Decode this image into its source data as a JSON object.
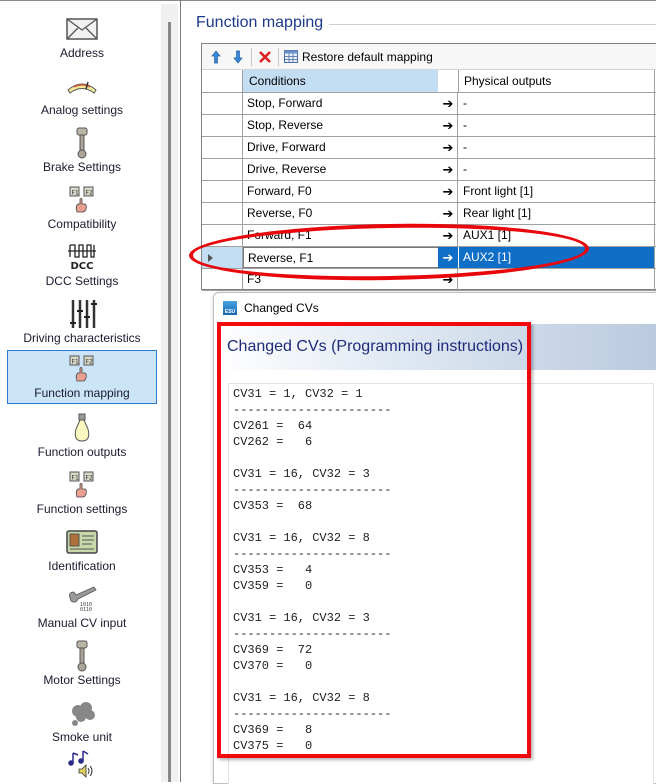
{
  "sidebar": {
    "items": [
      {
        "label": "Address",
        "icon": "envelope-icon",
        "selected": false
      },
      {
        "label": "Analog settings",
        "icon": "gauge-icon",
        "selected": false
      },
      {
        "label": "Brake Settings",
        "icon": "piston-icon",
        "selected": false
      },
      {
        "label": "Compatibility",
        "icon": "function-keys-hand-icon",
        "selected": false
      },
      {
        "label": "DCC Settings",
        "icon": "dcc-signal-icon",
        "icon_text": "DCC",
        "selected": false
      },
      {
        "label": "Driving characteristics",
        "icon": "sliders-icon",
        "selected": false
      },
      {
        "label": "Function mapping",
        "icon": "function-keys-hand-icon",
        "selected": true
      },
      {
        "label": "Function outputs",
        "icon": "light-bulb-icon",
        "selected": false
      },
      {
        "label": "Function settings",
        "icon": "function-keys-hand-icon",
        "selected": false
      },
      {
        "label": "Identification",
        "icon": "id-card-icon",
        "selected": false
      },
      {
        "label": "Manual CV input",
        "icon": "wrench-binary-icon",
        "selected": false
      },
      {
        "label": "Motor Settings",
        "icon": "piston-icon",
        "selected": false
      },
      {
        "label": "Smoke unit",
        "icon": "smoke-icon",
        "selected": false
      },
      {
        "label": "",
        "icon": "sound-notes-icon",
        "selected": false
      }
    ]
  },
  "main": {
    "group_title": "Function mapping",
    "toolbar": {
      "move_up": "arrow-up-icon",
      "move_down": "arrow-down-icon",
      "delete": "delete-x-icon",
      "restore_label": "Restore default mapping"
    },
    "table": {
      "columns": [
        "Conditions",
        "Physical outputs"
      ],
      "arrow_glyph": "➔",
      "rows": [
        {
          "condition": "Stop, Forward",
          "output": "-"
        },
        {
          "condition": "Stop, Reverse",
          "output": "-"
        },
        {
          "condition": "Drive, Forward",
          "output": "-"
        },
        {
          "condition": "Drive, Reverse",
          "output": "-"
        },
        {
          "condition": "Forward, F0",
          "output": "Front light [1]"
        },
        {
          "condition": "Reverse, F0",
          "output": "Rear light [1]"
        },
        {
          "condition": "Forward, F1",
          "output": "AUX1 [1]"
        },
        {
          "condition": "Reverse, F1",
          "output": "AUX2 [1]",
          "selected": true
        },
        {
          "condition": "F3",
          "output": ""
        }
      ]
    }
  },
  "dialog": {
    "title": "Changed CVs",
    "app_icon": "ESU",
    "banner": "Changed CVs (Programming instructions)",
    "cv_lines": [
      "CV31 = 1, CV32 = 1",
      "----------------------",
      "CV261 =  64",
      "CV262 =   6",
      "",
      "CV31 = 16, CV32 = 3",
      "----------------------",
      "CV353 =  68",
      "",
      "CV31 = 16, CV32 = 8",
      "----------------------",
      "CV353 =   4",
      "CV359 =   0",
      "",
      "CV31 = 16, CV32 = 3",
      "----------------------",
      "CV369 =  72",
      "CV370 =   0",
      "",
      "CV31 = 16, CV32 = 8",
      "----------------------",
      "CV369 =   8",
      "CV375 =   0"
    ]
  },
  "annotations": {
    "highlight_color": "#e8070b"
  }
}
